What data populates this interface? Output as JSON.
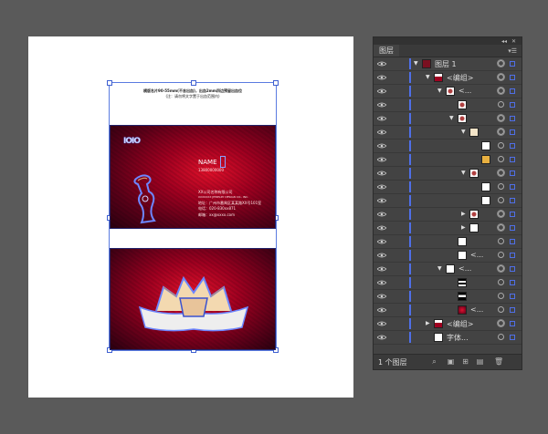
{
  "artboard": {
    "header_line1": "横版名片90-55mm(不含出血)，出血2mm四边预留出血位",
    "header_line2": "(注：请勿将文字置于出血范围内)"
  },
  "card_front": {
    "logo": "IOIO",
    "name": "NAME",
    "phone": "13800000000",
    "company_cn": "XX公司名称有限公司",
    "company_en": "XXXXXXX JEWELRY DESIGN CO., INC.",
    "address": "地址：广州市番禺区某某路XX号101室",
    "tel": "电话：020-830xx871",
    "email": "邮箱：xx@xxxx.com"
  },
  "panel": {
    "tab": "图层",
    "menu_icon": "panel-menu-icon",
    "footer_count": "1 个图层",
    "rows": [
      {
        "label": "图层 1",
        "indent": 0,
        "expanded": true,
        "thumb": "layer"
      },
      {
        "label": "<编组>",
        "indent": 1,
        "expanded": true,
        "thumb": "card"
      },
      {
        "label": "<...",
        "indent": 2,
        "expanded": true,
        "thumb": "figure"
      },
      {
        "label": "",
        "indent": 3,
        "expanded": null,
        "thumb": "figure"
      },
      {
        "label": "",
        "indent": 3,
        "expanded": true,
        "thumb": "figure"
      },
      {
        "label": "",
        "indent": 4,
        "expanded": true,
        "thumb": "beige"
      },
      {
        "label": "",
        "indent": 5,
        "expanded": null,
        "thumb": "white"
      },
      {
        "label": "",
        "indent": 5,
        "expanded": null,
        "thumb": "gold"
      },
      {
        "label": "",
        "indent": 4,
        "expanded": true,
        "thumb": "figure"
      },
      {
        "label": "",
        "indent": 5,
        "expanded": null,
        "thumb": "white"
      },
      {
        "label": "",
        "indent": 5,
        "expanded": null,
        "thumb": "white"
      },
      {
        "label": "",
        "indent": 4,
        "expanded": false,
        "thumb": "figure"
      },
      {
        "label": "",
        "indent": 4,
        "expanded": false,
        "thumb": "white"
      },
      {
        "label": "",
        "indent": 3,
        "expanded": null,
        "thumb": "white"
      },
      {
        "label": "<...",
        "indent": 3,
        "expanded": null,
        "thumb": "white"
      },
      {
        "label": "<...",
        "indent": 2,
        "expanded": true,
        "thumb": "white"
      },
      {
        "label": "",
        "indent": 3,
        "expanded": null,
        "thumb": "lines"
      },
      {
        "label": "",
        "indent": 3,
        "expanded": null,
        "thumb": "lines2"
      },
      {
        "label": "<...",
        "indent": 3,
        "expanded": null,
        "thumb": "red"
      },
      {
        "label": "<编组>",
        "indent": 1,
        "expanded": false,
        "thumb": "card"
      },
      {
        "label": "字体...",
        "indent": 1,
        "expanded": null,
        "thumb": "white"
      }
    ]
  },
  "colors": {
    "accent": "#4f6fe8",
    "card_red": "#c0102a"
  }
}
